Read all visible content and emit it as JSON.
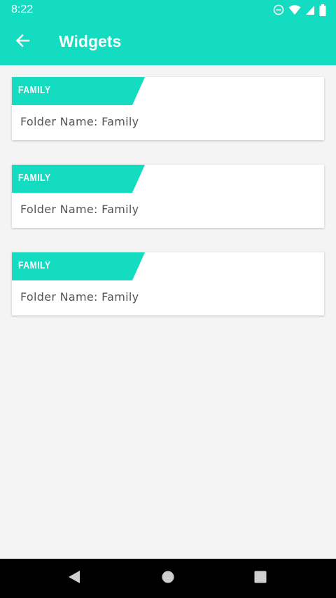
{
  "status_bar": {
    "time": "8:22",
    "icons": [
      "do-not-disturb-icon",
      "wifi-icon",
      "cell-signal-icon",
      "battery-icon"
    ]
  },
  "app_bar": {
    "back_icon": "arrow-left-icon",
    "title": "Widgets"
  },
  "cards": [
    {
      "tag": "FAMILY",
      "text": "Folder Name: Family"
    },
    {
      "tag": "FAMILY",
      "text": "Folder Name: Family"
    },
    {
      "tag": "FAMILY",
      "text": "Folder Name: Family"
    }
  ],
  "nav_bar": {
    "buttons": [
      "back-triangle-icon",
      "home-circle-icon",
      "recents-square-icon"
    ]
  },
  "colors": {
    "accent": "#13dcc0",
    "background": "#f4f4f4",
    "card": "#ffffff",
    "text": "#555555",
    "nav": "#000000"
  }
}
